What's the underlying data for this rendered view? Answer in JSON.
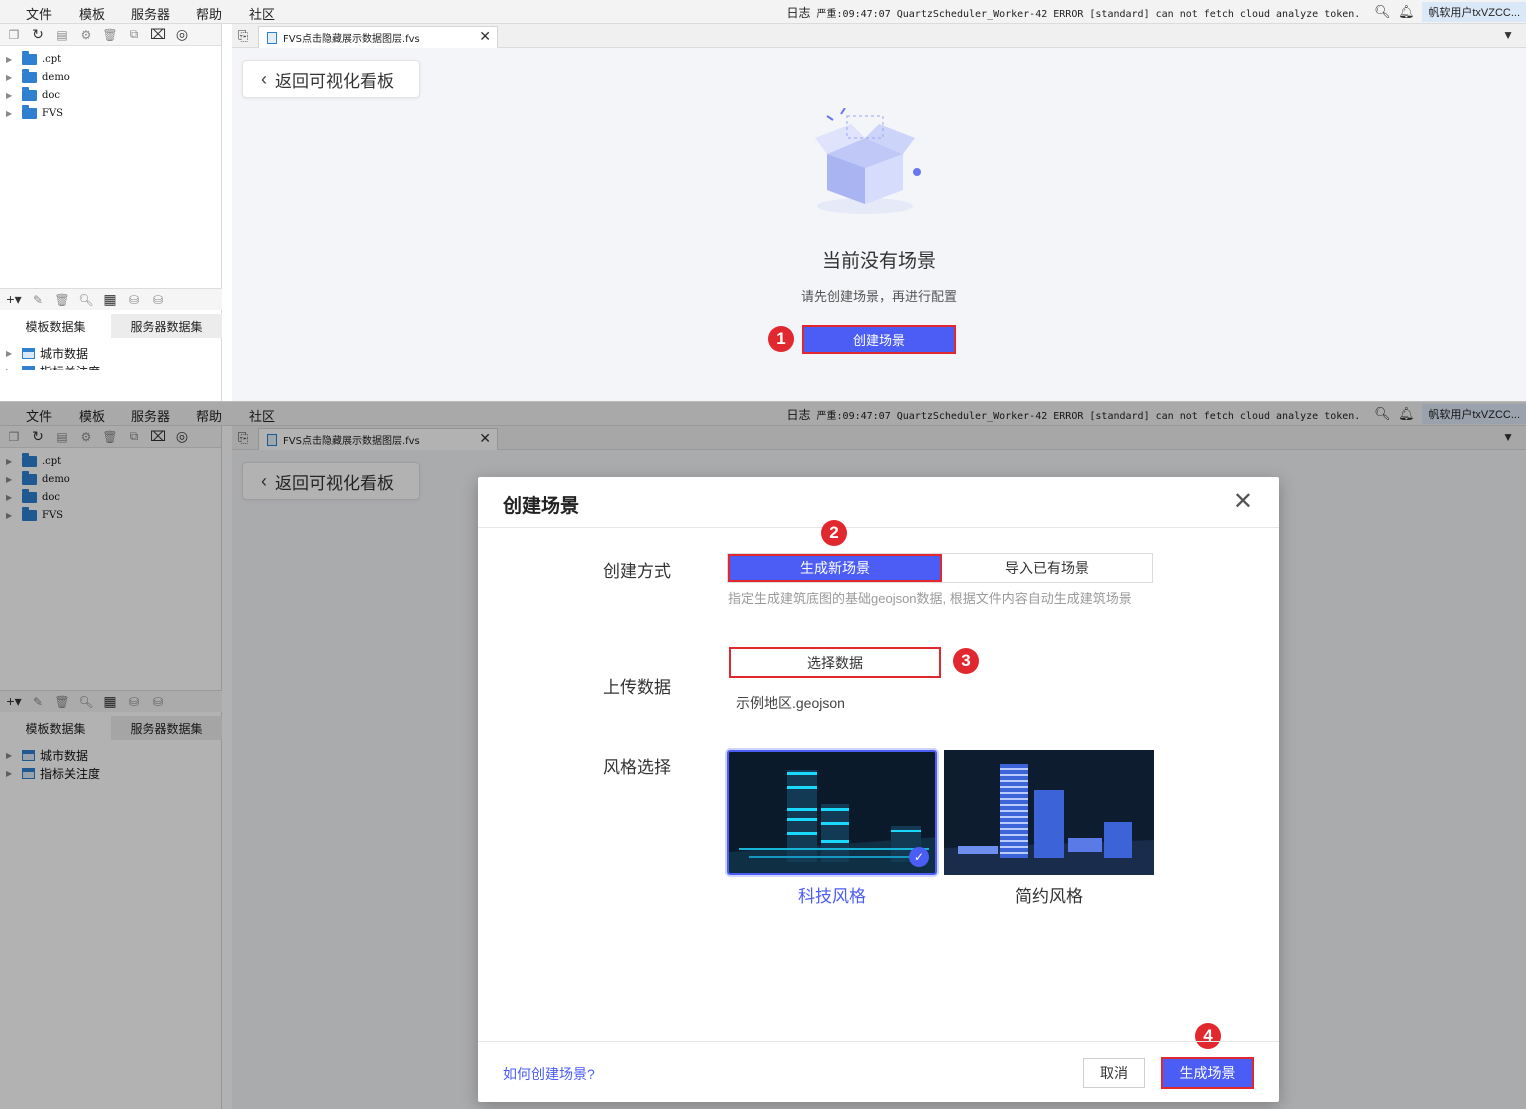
{
  "menu": {
    "items": [
      "文件",
      "模板",
      "服务器",
      "帮助",
      "社区"
    ],
    "log": "日志",
    "log_message": "严重:09:47:07 QuartzScheduler_Worker-42 ERROR [standard] can not fetch cloud analyze token.",
    "user": "帆软用户txVZCC..."
  },
  "file_tree": [
    ".cpt",
    "demo",
    "doc",
    "FVS"
  ],
  "dataset_tabs": [
    "模板数据集",
    "服务器数据集"
  ],
  "datasets": [
    "城市数据",
    "指标关注度"
  ],
  "editor": {
    "tab_title": "FVS点击隐藏展示数据图层.fvs",
    "back_label": "返回可视化看板"
  },
  "empty_state": {
    "title": "当前没有场景",
    "subtitle": "请先创建场景，再进行配置",
    "create_label": "创建场景"
  },
  "steps": [
    "1",
    "2",
    "3",
    "4"
  ],
  "dialog": {
    "title": "创建场景",
    "method_label": "创建方式",
    "method_options": [
      "生成新场景",
      "导入已有场景"
    ],
    "method_selected": "生成新场景",
    "hint": "指定生成建筑底图的基础geojson数据, 根据文件内容自动生成建筑场景",
    "upload_label": "上传数据",
    "select_data_label": "选择数据",
    "file_name": "示例地区.geojson",
    "style_label": "风格选择",
    "styles": [
      {
        "name": "科技风格",
        "selected": true
      },
      {
        "name": "简约风格",
        "selected": false
      }
    ],
    "help_link": "如何创建场景?",
    "cancel_label": "取消",
    "generate_label": "生成场景"
  },
  "colors": {
    "accent": "#4b5df5",
    "highlight_red": "#e0282e",
    "folder_blue": "#2f80d1"
  }
}
